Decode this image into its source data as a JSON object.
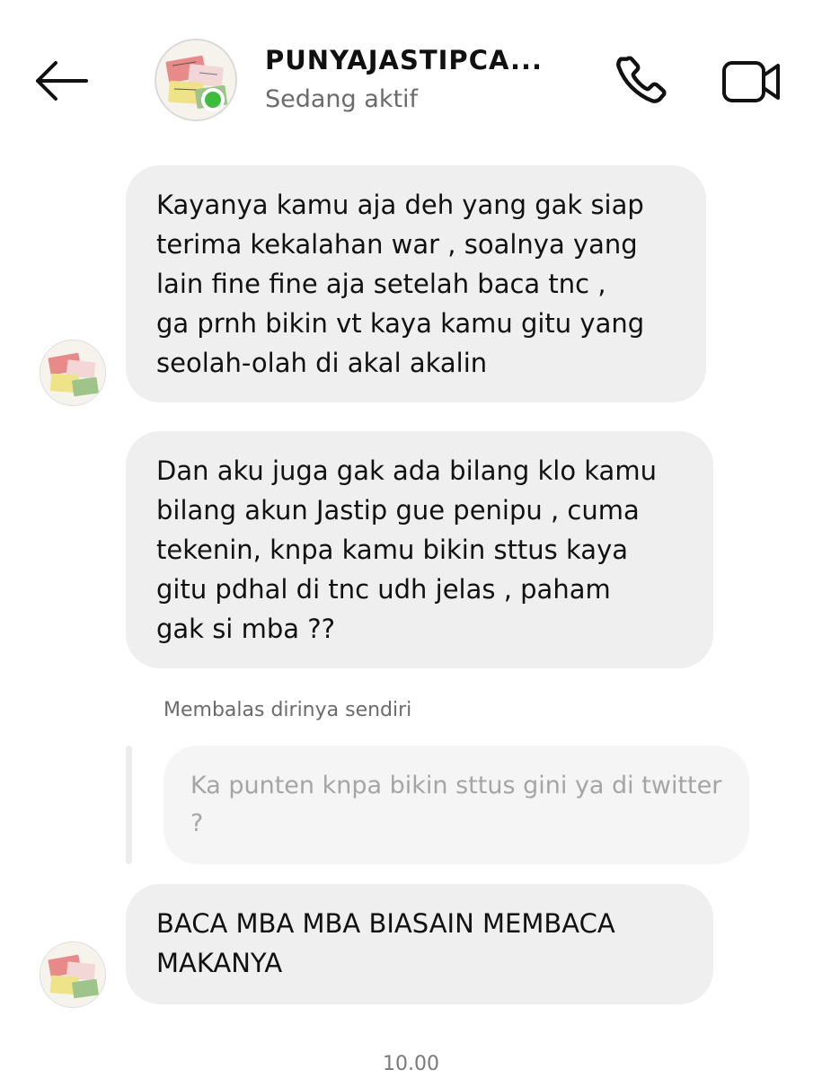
{
  "header": {
    "title": "PUNYAJASTIPCA...",
    "status": "Sedang aktif",
    "icons": {
      "back": "back-arrow-icon",
      "call": "phone-icon",
      "video": "video-camera-icon"
    },
    "online_color": "#3cbe3c"
  },
  "messages": [
    {
      "text": "Kayanya kamu aja deh yang gak siap\nterima kekalahan war , soalnya yang\nlain fine fine aja setelah baca tnc ,\nga prnh bikin vt kaya kamu gitu yang\nseolah-olah di akal akalin"
    },
    {
      "text": "Dan aku juga gak ada bilang klo kamu\nbilang akun Jastip gue penipu , cuma\ntekenin, knpa kamu bikin sttus kaya\ngitu pdhal di tnc udh jelas , paham\ngak si mba ??"
    },
    {
      "reply_label": "Membalas dirinya sendiri",
      "reply_text": "Ka punten knpa bikin sttus gini ya di twitter ?",
      "text": "BACA MBA MBA BIASAIN MEMBACA\nMAKANYA"
    }
  ],
  "timestamp": "10.00",
  "colors": {
    "bubble": "#efefef",
    "reply_bubble": "#f5f5f5",
    "secondary_text": "#6b6b6b"
  }
}
